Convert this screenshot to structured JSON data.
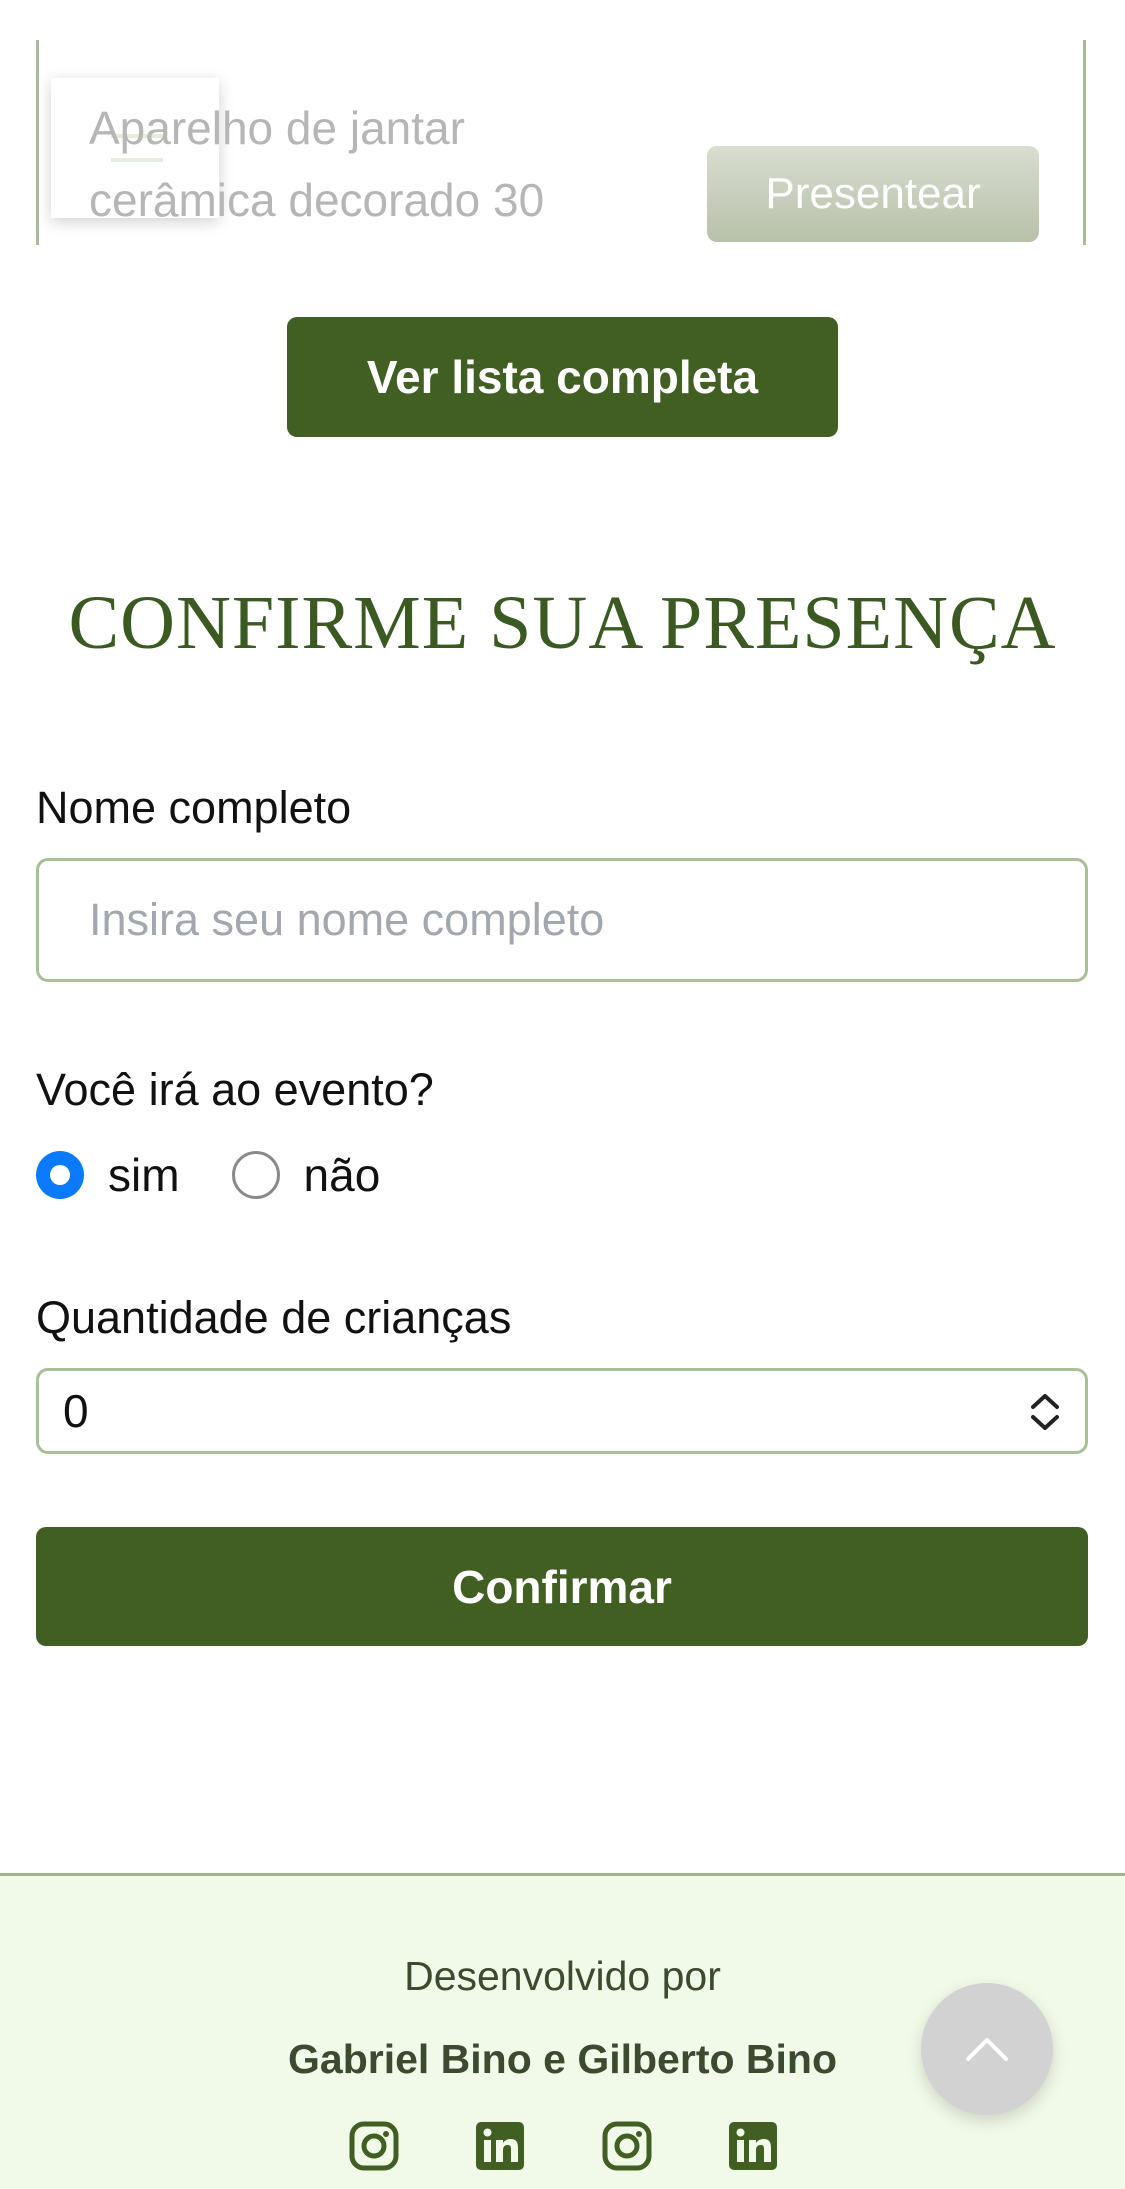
{
  "gift": {
    "name": "Aparelho de jantar cerâmica decorado 30",
    "present_label": "Presentear"
  },
  "gifts_section": {
    "view_all_label": "Ver lista completa"
  },
  "rsvp": {
    "title": "CONFIRME SUA PRESENÇA",
    "name_label": "Nome completo",
    "name_placeholder": "Insira seu nome completo",
    "name_value": "",
    "attend_question": "Você irá ao evento?",
    "options": [
      {
        "label": "sim",
        "selected": true
      },
      {
        "label": "não",
        "selected": false
      }
    ],
    "children_label": "Quantidade de crianças",
    "children_value": "0",
    "confirm_label": "Confirmar"
  },
  "footer": {
    "developed_by": "Desenvolvido por",
    "developers": "Gabriel Bino e Gilberto Bino",
    "social_icons": [
      "instagram-icon",
      "linkedin-icon",
      "instagram-icon",
      "linkedin-icon"
    ]
  },
  "colors": {
    "primary": "#425f23",
    "title": "#3a5a22",
    "footer_bg": "#f1f9e8",
    "input_border": "#a9bf97",
    "radio_selected": "#0a7aff"
  }
}
